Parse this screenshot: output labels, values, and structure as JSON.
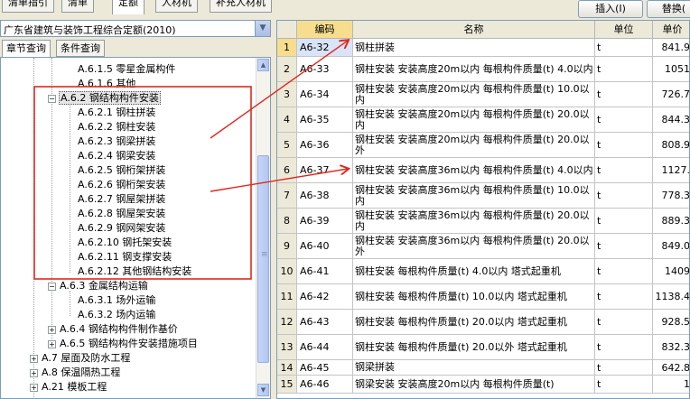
{
  "top_tabs": [
    "清单指引",
    "清单",
    "定额",
    "人材机",
    "补充人材机"
  ],
  "top_buttons": {
    "insert": "插入(I)",
    "replace": "替换("
  },
  "library": "广东省建筑与装饰工程综合定额(2010)",
  "sub_tabs": [
    "章节查询",
    "条件查询"
  ],
  "tree": [
    {
      "label": "A.6.1.5 零星金属构件"
    },
    {
      "label": "A.6.1.6 其他"
    },
    {
      "label": "A.6.2 钢结构构件安装",
      "toggle": "−"
    },
    {
      "label": "A.6.2.1 钢柱拼装"
    },
    {
      "label": "A.6.2.2 钢柱安装"
    },
    {
      "label": "A.6.2.3 钢梁拼装"
    },
    {
      "label": "A.6.2.4 钢梁安装"
    },
    {
      "label": "A.6.2.5 钢桁架拼装"
    },
    {
      "label": "A.6.2.6 钢桁架安装"
    },
    {
      "label": "A.6.2.7 钢屋架拼装"
    },
    {
      "label": "A.6.2.8 钢屋架安装"
    },
    {
      "label": "A.6.2.9 钢网架安装"
    },
    {
      "label": "A.6.2.10 钢托架安装"
    },
    {
      "label": "A.6.2.11 钢支撑安装"
    },
    {
      "label": "A.6.2.12 其他钢结构安装"
    },
    {
      "label": "A.6.3 金属结构运输",
      "toggle": "−"
    },
    {
      "label": "A.6.3.1 场外运输"
    },
    {
      "label": "A.6.3.2 场内运输"
    },
    {
      "label": "A.6.4 钢结构构件制作基价",
      "toggle": "+"
    },
    {
      "label": "A.6.5 钢结构构件安装措施项目",
      "toggle": "+"
    },
    {
      "label": "A.7 屋面及防水工程",
      "toggle": "+"
    },
    {
      "label": "A.8 保温隔热工程",
      "toggle": "+"
    },
    {
      "label": "A.21 模板工程",
      "toggle": "+"
    }
  ],
  "columns": {
    "code": "编码",
    "name": "名称",
    "unit": "单位",
    "price": "单价"
  },
  "rows": [
    {
      "no": "1",
      "code": "A6-32",
      "name": "钢柱拼装",
      "unit": "t",
      "price": "841.9"
    },
    {
      "no": "2",
      "code": "A6-33",
      "name": "钢柱安装 安装高度20m以内 每根构件质量(t) 4.0以内",
      "unit": "t",
      "price": "1051"
    },
    {
      "no": "3",
      "code": "A6-34",
      "name": "钢柱安装 安装高度20m以内 每根构件质量(t) 10.0以内",
      "unit": "t",
      "price": "726.7"
    },
    {
      "no": "4",
      "code": "A6-35",
      "name": "钢柱安装 安装高度20m以内 每根构件质量(t) 20.0以内",
      "unit": "t",
      "price": "844.3"
    },
    {
      "no": "5",
      "code": "A6-36",
      "name": "钢柱安装 安装高度20m以内 每根构件质量(t) 20.0以外",
      "unit": "t",
      "price": "808.9"
    },
    {
      "no": "6",
      "code": "A6-37",
      "name": "钢柱安装 安装高度36m以内 每根构件质量(t) 4.0以内",
      "unit": "t",
      "price": "1127."
    },
    {
      "no": "7",
      "code": "A6-38",
      "name": "钢柱安装 安装高度36m以内 每根构件质量(t) 10.0以内",
      "unit": "t",
      "price": "778.3"
    },
    {
      "no": "8",
      "code": "A6-39",
      "name": "钢柱安装 安装高度36m以内 每根构件质量(t) 20.0以内",
      "unit": "t",
      "price": "889.3"
    },
    {
      "no": "9",
      "code": "A6-40",
      "name": "钢柱安装 安装高度36m以内 每根构件质量(t) 20.0以外",
      "unit": "t",
      "price": "849.0"
    },
    {
      "no": "10",
      "code": "A6-41",
      "name": "钢柱安装 每根构件质量(t) 4.0以内 塔式起重机",
      "unit": "t",
      "price": "1409"
    },
    {
      "no": "11",
      "code": "A6-42",
      "name": "钢柱安装 每根构件质量(t) 10.0以内 塔式起重机",
      "unit": "t",
      "price": "1138.4"
    },
    {
      "no": "12",
      "code": "A6-43",
      "name": "钢柱安装 每根构件质量(t) 20.0以内 塔式起重机",
      "unit": "t",
      "price": "928.5"
    },
    {
      "no": "13",
      "code": "A6-44",
      "name": "钢柱安装 每根构件质量(t) 20.0以外 塔式起重机",
      "unit": "t",
      "price": "832.3"
    },
    {
      "no": "14",
      "code": "A6-45",
      "name": "钢梁拼装",
      "unit": "t",
      "price": "642.8"
    },
    {
      "no": "15",
      "code": "A6-46",
      "name": "钢梁安装 安装高度20m以内 每根构件质量(t)",
      "unit": "t",
      "price": "1"
    }
  ],
  "annotation_color": "#e0281e",
  "selection_color": "#f6de8e"
}
